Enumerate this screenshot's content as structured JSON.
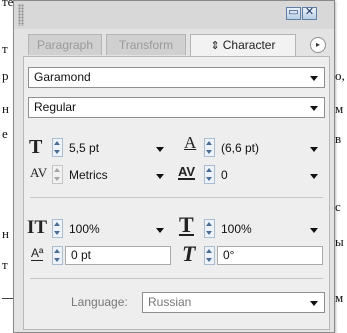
{
  "background_doc": {
    "fragments": [
      {
        "text": "текст"
      },
      {
        "text": "т"
      },
      {
        "text": "р"
      },
      {
        "text": "н"
      },
      {
        "text": "е"
      },
      {
        "text": "о,"
      },
      {
        "text": "м"
      },
      {
        "text": "в"
      },
      {
        "text": "с"
      },
      {
        "text": "н"
      },
      {
        "text": "ы"
      },
      {
        "text": "т"
      },
      {
        "text": "м"
      }
    ]
  },
  "window": {
    "minimize_glyph": "▭",
    "close_glyph": "✕"
  },
  "tabs": [
    {
      "label": "Paragraph"
    },
    {
      "label": "Transform"
    },
    {
      "label": "Character",
      "icon_glyph": "⇕"
    }
  ],
  "flyout_glyph": "▸",
  "font": {
    "family": "Garamond",
    "style": "Regular"
  },
  "size": {
    "value": "5,5 pt",
    "icon_glyph": "T"
  },
  "leading": {
    "value": "(6,6 pt)",
    "icon_glyph": "A"
  },
  "kerning": {
    "value": "Metrics",
    "icon_glyph": "AV"
  },
  "tracking": {
    "value": "0",
    "icon_glyph": "AV"
  },
  "vertical_scale": {
    "value": "100%",
    "icon_glyph": "IT"
  },
  "horizontal_scale": {
    "value": "100%",
    "icon_glyph": "T"
  },
  "baseline_shift": {
    "value": "0 pt",
    "icon_glyph": "Aª"
  },
  "skew": {
    "value": "0°",
    "icon_glyph": "T"
  },
  "language": {
    "label": "Language:",
    "value": "Russian"
  }
}
